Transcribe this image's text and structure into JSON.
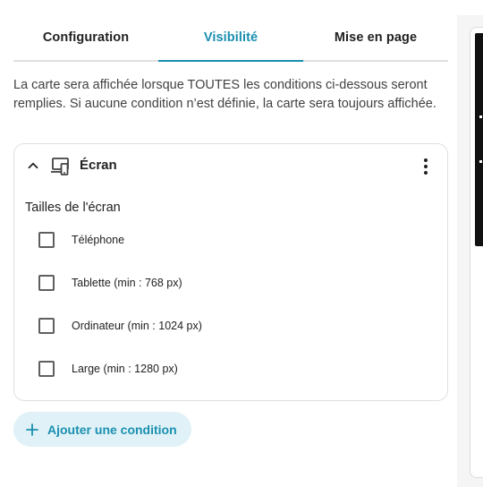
{
  "tabs": [
    {
      "label": "Configuration"
    },
    {
      "label": "Visibilité"
    },
    {
      "label": "Mise en page"
    }
  ],
  "active_tab": "Visibilité",
  "description": "La carte sera affichée lorsque TOUTES les conditions ci-dessous seront remplies. Si aucune condition n’est définie, la carte sera toujours affichée.",
  "condition": {
    "title": "Écran",
    "icons": {
      "collapse": "chevron-up-icon",
      "device": "monitor-cellphone-icon",
      "menu": "dots-vertical-icon"
    },
    "section_label": "Tailles de l'écran",
    "options": [
      {
        "label": "Téléphone",
        "checked": false
      },
      {
        "label": "Tablette (min : 768 px)",
        "checked": false
      },
      {
        "label": "Ordinateur (min : 1024 px)",
        "checked": false
      },
      {
        "label": "Large (min : 1280 px)",
        "checked": false
      }
    ]
  },
  "add_condition": {
    "label": "Ajouter une condition",
    "icon": "plus-icon"
  },
  "colors": {
    "accent": "#1a8fb0",
    "button_bg": "#e0f2f7",
    "border": "#e0e0e0"
  }
}
